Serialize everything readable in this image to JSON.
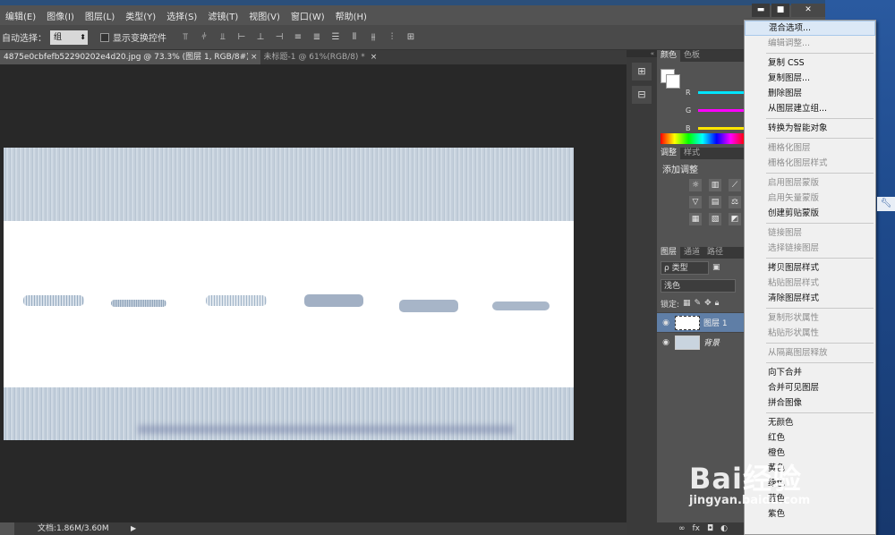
{
  "menubar": {
    "items": [
      "编辑(E)",
      "图像(I)",
      "图层(L)",
      "类型(Y)",
      "选择(S)",
      "滤镜(T)",
      "视图(V)",
      "窗口(W)",
      "帮助(H)"
    ]
  },
  "window_controls": {
    "minimize": "▬",
    "maximize": "■",
    "close": "✕"
  },
  "options_bar": {
    "auto_select_label": "自动选择：",
    "auto_select_value": "组",
    "show_transform_label": "显示变换控件"
  },
  "tabs": [
    {
      "label": "4875e0cbfefb52290202e4d20.jpg @ 73.3% (图层 1, RGB/8#) *",
      "close": "×"
    },
    {
      "label": "未标题-1 @ 61%(RGB/8) *",
      "close": "×"
    }
  ],
  "status": {
    "doc": "文档:1.86M/3.60M"
  },
  "color_panel": {
    "tabs": [
      "颜色",
      "色板"
    ],
    "channels": [
      {
        "name": "R",
        "color": "#00e5ff"
      },
      {
        "name": "G",
        "color": "#ff00ff"
      },
      {
        "name": "B",
        "color": "#ffe600"
      }
    ]
  },
  "adjust_panel": {
    "tabs": [
      "调整",
      "样式"
    ],
    "title": "添加调整"
  },
  "layers_panel": {
    "tabs": [
      "图层",
      "通道",
      "路径"
    ],
    "kind_label": "ρ 类型",
    "blend_mode": "浅色",
    "lock_label": "锁定:",
    "layers": [
      {
        "name": "图层 1",
        "selected": true,
        "italic": false
      },
      {
        "name": "背景",
        "selected": false,
        "italic": true
      }
    ]
  },
  "context_menu": {
    "items": [
      {
        "label": "混合选项...",
        "enabled": true,
        "highlighted": true
      },
      {
        "label": "编辑调整...",
        "enabled": false
      },
      {
        "sep": true
      },
      {
        "label": "复制 CSS",
        "enabled": true
      },
      {
        "label": "复制图层...",
        "enabled": true
      },
      {
        "label": "删除图层",
        "enabled": true
      },
      {
        "label": "从图层建立组...",
        "enabled": true
      },
      {
        "sep": true
      },
      {
        "label": "转换为智能对象",
        "enabled": true
      },
      {
        "sep": true
      },
      {
        "label": "栅格化图层",
        "enabled": false
      },
      {
        "label": "栅格化图层样式",
        "enabled": false
      },
      {
        "sep": true
      },
      {
        "label": "启用图层蒙版",
        "enabled": false
      },
      {
        "label": "启用矢量蒙版",
        "enabled": false
      },
      {
        "label": "创建剪贴蒙版",
        "enabled": true
      },
      {
        "sep": true
      },
      {
        "label": "链接图层",
        "enabled": false
      },
      {
        "label": "选择链接图层",
        "enabled": false
      },
      {
        "sep": true
      },
      {
        "label": "拷贝图层样式",
        "enabled": true
      },
      {
        "label": "粘贴图层样式",
        "enabled": false
      },
      {
        "label": "清除图层样式",
        "enabled": true
      },
      {
        "sep": true
      },
      {
        "label": "复制形状属性",
        "enabled": false
      },
      {
        "label": "粘贴形状属性",
        "enabled": false
      },
      {
        "sep": true
      },
      {
        "label": "从隔离图层释放",
        "enabled": false
      },
      {
        "sep": true
      },
      {
        "label": "向下合并",
        "enabled": true
      },
      {
        "label": "合并可见图层",
        "enabled": true
      },
      {
        "label": "拼合图像",
        "enabled": true
      },
      {
        "sep": true
      },
      {
        "label": "无颜色",
        "enabled": true
      },
      {
        "label": "红色",
        "enabled": true
      },
      {
        "label": "橙色",
        "enabled": true
      },
      {
        "label": "黄色",
        "enabled": true
      },
      {
        "label": "绿色",
        "enabled": true
      },
      {
        "label": "蓝色",
        "enabled": true
      },
      {
        "label": "紫色",
        "enabled": true
      }
    ]
  },
  "watermark": {
    "text": "Bai经验",
    "sub": "jingyan.baidu.com"
  }
}
